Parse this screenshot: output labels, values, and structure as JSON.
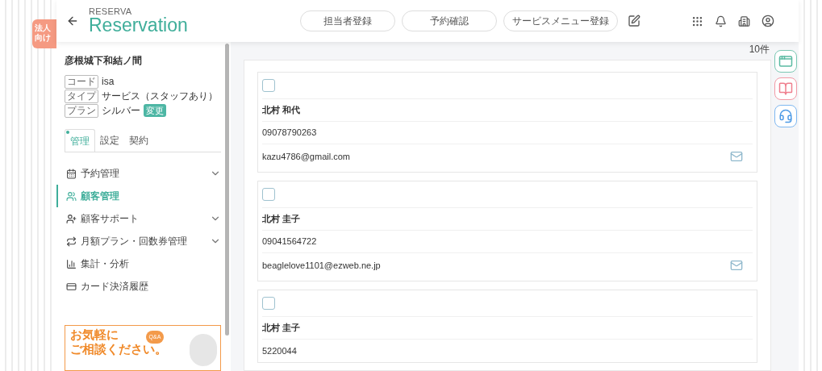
{
  "background": {
    "badge": "法人向け"
  },
  "logo": {
    "small": "RESERVA",
    "large": "Reservation"
  },
  "shop": {
    "name": "彦根城下和結ノ間",
    "fields": [
      {
        "tag": "コード",
        "value": "isa"
      },
      {
        "tag": "タイプ",
        "value": "サービス（スタッフあり）"
      },
      {
        "tag": "プラン",
        "value": "シルバー",
        "badge": "変更"
      }
    ]
  },
  "tabs": [
    {
      "label": "管理",
      "selected": true
    },
    {
      "label": "設定",
      "selected": false
    },
    {
      "label": "契約",
      "selected": false
    }
  ],
  "menu": [
    {
      "kind": "calendar",
      "label": "予約管理",
      "selected": false,
      "expandable": true
    },
    {
      "kind": "users",
      "label": "顧客管理",
      "selected": true,
      "expandable": false
    },
    {
      "kind": "user-plus",
      "label": "顧客サポート",
      "selected": false,
      "expandable": true
    },
    {
      "kind": "repeat",
      "label": "月額プラン・回数券管理",
      "selected": false,
      "expandable": true
    },
    {
      "kind": "chart",
      "label": "集計・分析",
      "selected": false,
      "expandable": false
    },
    {
      "kind": "card",
      "label": "カード決済履歴",
      "selected": false,
      "expandable": false
    }
  ],
  "promo": {
    "headline": "お気軽に",
    "headline2": "ご相談ください。",
    "bubble": "Q&A"
  },
  "header_buttons": [
    "担当者登録",
    "予約確認",
    "サービスメニュー登録"
  ],
  "count": "10件",
  "customers": [
    {
      "checked": false,
      "name": "北村 和代",
      "phone": "09078790263",
      "email": "kazu4786@gmail.com"
    },
    {
      "checked": false,
      "name": "北村 圭子",
      "phone": "09041564722",
      "email": "beaglelove1101@ezweb.ne.jp"
    },
    {
      "checked": false,
      "name": "北村 圭子",
      "phone": "5220044"
    }
  ]
}
